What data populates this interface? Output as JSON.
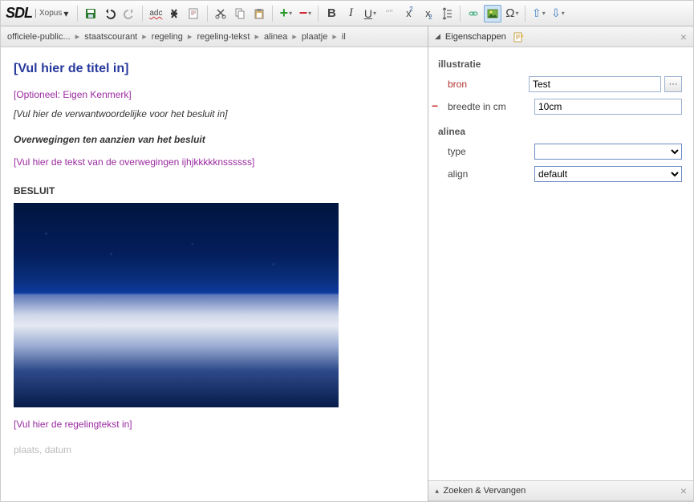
{
  "brand": {
    "logo": "SDL",
    "product": "Xopus"
  },
  "breadcrumbs": [
    "officiele-public...",
    "staatscourant",
    "regeling",
    "regeling-tekst",
    "alinea",
    "plaatje",
    "il"
  ],
  "editor": {
    "title": "[Vul hier de titel in]",
    "kenmerk": "[Optioneel: Eigen Kenmerk]",
    "verantwoordelijke": "[Vul hier de verwantwoordelijke voor het besluit in]",
    "overwegingen_head": "Overwegingen ten aanzien van het besluit",
    "overwegingen_text": "[Vul hier de tekst van de overwegingen ijhjkkkkknssssss]",
    "besluit": "BESLUIT",
    "regelingtekst": "[Vul hier de regelingtekst in]",
    "plaats_datum": "plaats, datum"
  },
  "panes": {
    "properties": {
      "title": "Eigenschappen",
      "groups": {
        "illustratie": {
          "label": "illustratie",
          "bron": {
            "label": "bron",
            "value": "Test"
          },
          "breedte": {
            "label": "breedte in cm",
            "value": "10cm"
          }
        },
        "alinea": {
          "label": "alinea",
          "type": {
            "label": "type",
            "value": ""
          },
          "align": {
            "label": "align",
            "value": "default"
          }
        }
      }
    },
    "search": {
      "title": "Zoeken & Vervangen"
    }
  }
}
